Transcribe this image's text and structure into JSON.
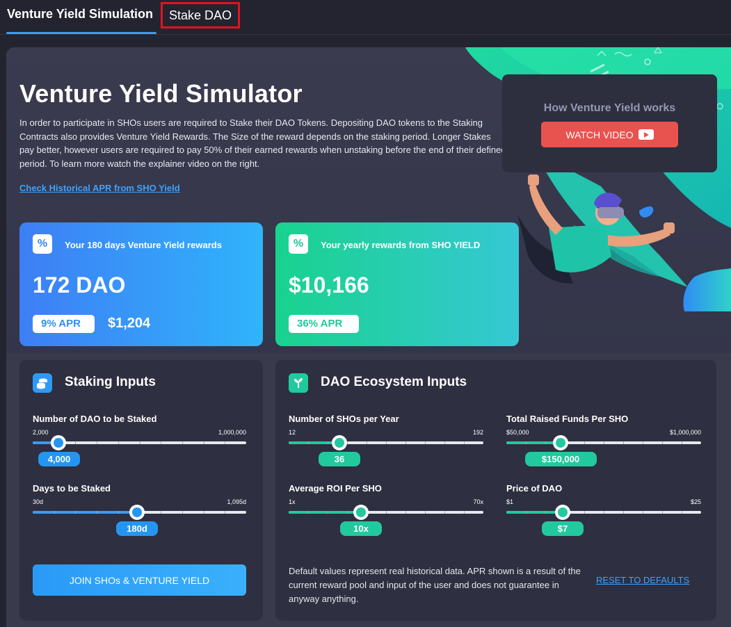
{
  "tabs": {
    "active": "Venture Yield Simulation",
    "second": "Stake DAO"
  },
  "hero": {
    "title": "Venture Yield Simulator",
    "description": "In order to participate in SHOs users are required to Stake their DAO Tokens. Depositing DAO tokens to the Staking Contracts also provides Venture Yield Rewards. The Size of the reward depends on the staking period. Longer Stakes pay better, however users are required to pay 50% of their earned rewards when unstaking before the end of their defined period. To learn more watch the explainer video on the right.",
    "history_link": "Check Historical APR from SHO Yield"
  },
  "video": {
    "title": "How Venture Yield works",
    "button": "WATCH VIDEO"
  },
  "cards": {
    "venture": {
      "icon": "percent-icon",
      "label": "Your 180 days Venture Yield rewards",
      "value": "172 DAO",
      "apr": "9% APR",
      "usd": "$1,204"
    },
    "sho": {
      "icon": "percent-icon",
      "label": "Your yearly rewards from SHO YIELD",
      "value": "$10,166",
      "apr": "36% APR"
    }
  },
  "staking": {
    "title": "Staking Inputs",
    "icon": "coins-icon",
    "amount": {
      "label": "Number of DAO to be Staked",
      "min": "2,000",
      "max": "1,000,000",
      "value": "4,000",
      "position": 0.12
    },
    "days": {
      "label": "Days to be Staked",
      "min": "30d",
      "max": "1,095d",
      "value": "180d",
      "position": 0.49
    },
    "join_button": "JOIN SHOs & VENTURE YIELD"
  },
  "ecosystem": {
    "title": "DAO Ecosystem Inputs",
    "icon": "sprout-icon",
    "shos": {
      "label": "Number of SHOs per Year",
      "min": "12",
      "max": "192",
      "value": "36",
      "position": 0.26
    },
    "funds": {
      "label": "Total Raised Funds Per SHO",
      "min": "$50,000",
      "max": "$1,000,000",
      "value": "$150,000",
      "position": 0.28
    },
    "roi": {
      "label": "Average ROI Per SHO",
      "min": "1x",
      "max": "70x",
      "value": "10x",
      "position": 0.37
    },
    "price": {
      "label": "Price of DAO",
      "min": "$1",
      "max": "$25",
      "value": "$7",
      "position": 0.29
    },
    "disclaimer": "Default values represent real historical data. APR shown is a result of the current reward pool and input of the user and does not guarantee in anyway anything.",
    "reset": "RESET TO DEFAULTS"
  },
  "colors": {
    "blue_accent": "#2496f2",
    "green_accent": "#22c99e",
    "video_button": "#e8524f",
    "tab_highlight": "#e0141e"
  }
}
